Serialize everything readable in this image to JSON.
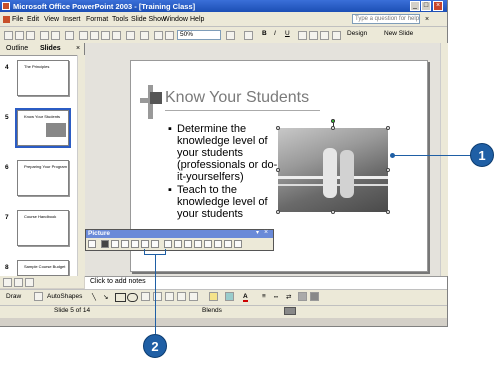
{
  "window": {
    "title": "Microsoft Office PowerPoint 2003 - [Training Class]",
    "min_label": "_",
    "max_label": "□",
    "close_label": "×"
  },
  "menu": [
    "File",
    "Edit",
    "View",
    "Insert",
    "Format",
    "Tools",
    "Slide Show",
    "Window",
    "Help"
  ],
  "help_placeholder": "Type a question for help",
  "toolbar": {
    "zoom": "50%",
    "design_label": "Design",
    "new_slide_label": "New Slide"
  },
  "pane": {
    "tabs": [
      "Outline",
      "Slides"
    ],
    "close_label": "×",
    "slides": [
      {
        "number": "4",
        "title": "The Principles"
      },
      {
        "number": "5",
        "title": "Know Your Students"
      },
      {
        "number": "6",
        "title": "Preparing Your Program"
      },
      {
        "number": "7",
        "title": "Course Handbook"
      },
      {
        "number": "8",
        "title": "Sample Course Budget"
      }
    ]
  },
  "slide": {
    "title": "Know Your Students",
    "bullets": [
      "Determine the knowledge level of your students (professionals or do-it-yourselfers)",
      "Teach to the knowledge level of your students"
    ]
  },
  "picture_toolbar": {
    "title": "Picture"
  },
  "notes_placeholder": "Click to add notes",
  "drawbar": {
    "draw_label": "Draw",
    "autoshapes_label": "AutoShapes"
  },
  "status": {
    "slide_pos": "Slide 5 of 14",
    "design": "Blends"
  },
  "callouts": [
    "1",
    "2"
  ]
}
